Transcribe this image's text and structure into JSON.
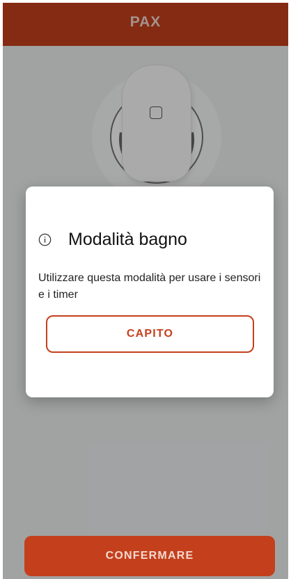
{
  "header": {
    "brand": "PAX"
  },
  "dialog": {
    "icon": "info-icon",
    "title": "Modalità bagno",
    "message": "Utilizzare questa modalità per usare i sensori e i timer",
    "got_it_label": "CAPITO"
  },
  "footer": {
    "confirm_label": "CONFERMARE"
  },
  "colors": {
    "brand": "#c4401c",
    "background": "#eef0f1",
    "dialog": "#ffffff"
  }
}
